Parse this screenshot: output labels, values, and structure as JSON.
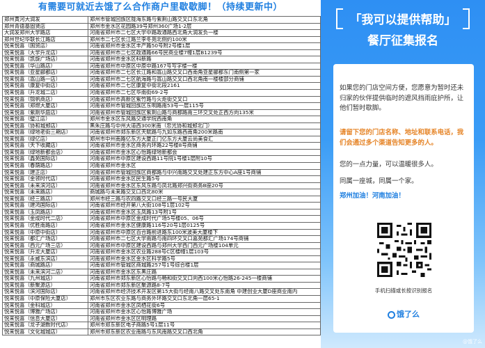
{
  "left": {
    "title": "有需要可就近去饿了么合作商户里歇歇脚！（持续更新中）",
    "rows": [
      [
        "郑州黄河大润发",
        "郑州市管城回族区陇海东路与紫荆山路交叉口东北角"
      ],
      [
        "郑州青德基固贤店",
        "郑州市金水区花园路39号郑州360广场1-2层"
      ],
      [
        "大润发郑州大学路店",
        "河南省郑州市二七区大学中路政通路西北角大润发负一楼"
      ],
      [
        "郑州世纪华联长江路店",
        "郑州市二七区长江路兰李冬苑北侧约100米"
      ],
      [
        "悦来悦喜（国贸店）",
        "河南省郑州市金水区丰产路50号附2号楼1层"
      ],
      [
        "悦来悦喜（大学升龙店）",
        "河南省郑州市二七区政通路66号民商业楼7幢1层B1239号"
      ],
      [
        "悦来悦喜（凯旋广场店）",
        "河南省郑州市金水区科新路"
      ],
      [
        "悦来悦喜（华山路店）",
        "河南省郑州市中原区中原中路167号写字楼一楼"
      ],
      [
        "悦来悦喜（亚星郦都店）",
        "河南省郑州市二七区长江路和嵩山路交叉口西南角亚星郦都东门南侧第一家"
      ],
      [
        "悦来悦喜（嵩山路一店）",
        "河南省郑州市二七区航海路与嵩山路交叉口西北角南一楼楼部分商铺"
      ],
      [
        "悦来悦喜（康复中街店）",
        "河南省郑州市二七区康复中街北段2161"
      ],
      [
        "悦来悦喜（升龙城二店）",
        "河南省郑州市二七区华南街69-2号"
      ],
      [
        "悦来悦喜（锦帆商店）",
        "河南省郑州市高新区紫竹路与火炬街交叉口"
      ],
      [
        "悦来悦喜（郑燃大厦店）",
        "河南省郑州市管城回族区东明路南53号一层115号"
      ],
      [
        "悦来悦喜（紫荆华庭店）",
        "河南省郑州市管城回族区紫荆山路与商都路南三环交叉处正西方向135米"
      ],
      [
        "悦来悦喜（璧江店）",
        "郑州市金水区东风路交通学院西南角"
      ],
      [
        "悦来悦喜（协和城郏店）",
        "黑朱庄路与中州大道西300米南（忠光协和城郏北门）"
      ],
      [
        "悦来悦喜（绿地老街三期店）",
        "河南省郑州市郑东新区天赋路与九如东路西南角200米路南"
      ],
      [
        "悦来悦喜（绿亿店）",
        "郑州市中州南路亿东方大厦正门亿东方大厦云尚美食汇"
      ],
      [
        "悦来悦喜（天下收藏店）",
        "河南省郑州市金水区商务内环路22号楼8号商铺"
      ],
      [
        "悦来悦喜（绿地新都会店）",
        "河南省郑州市金水区心怡路绿地新都会"
      ],
      [
        "悦来悦喜（鑫苑国际店）",
        "河南省郑州市中原区建设西路11号院1号楼1层附10号"
      ],
      [
        "悦来悦喜（春荫路店）",
        "河南省郑州市金水区"
      ],
      [
        "悦来悦喜（建正店）",
        "河南省郑州市管城回族区商都路与中兴南路交叉处建正东方中心A座1号商铺"
      ],
      [
        "悦来悦喜（金领时代店）",
        "河南省郑州市金水区民生路5号"
      ],
      [
        "悦来悦喜（未来滨河店）",
        "河南省郑州市金水区东风东路与凤北路郑兴街商务B座20号"
      ],
      [
        "悦来悦喜（未来路店）",
        "商城路与未来路交叉口西北80米"
      ],
      [
        "悦来悦喜（经三路店）",
        "郑州市经三路与农四路交叉口经三路一号民大厦"
      ],
      [
        "悦来悦喜（建鸿国际店）",
        "河南省郑州市经开第八大街108号1层102号"
      ],
      [
        "悦来悦喜（玉凤路店）",
        "河南省郑州市金水区玉凤路13号附1号"
      ],
      [
        "悦来悦喜（金成时代二店）",
        "河南省郑州市中原区金成时代广场5号楼05、06号"
      ],
      [
        "悦来悦喜（优胜南路店）",
        "河南省郑州市金水区健康路116号20号1层0125号"
      ],
      [
        "悦来悦喜（中原中街店）",
        "河南省郑州市中原区百合路前进路东100米波美大厦楼下"
      ],
      [
        "悦来悦喜（都汇广场店）",
        "河南省郑州市二七区大学南路与南四环交叉口嘉苑都汇广场174号商铺"
      ],
      [
        "悦来悦喜（西元广场三店）",
        "河南省郑州市中原区建设西路与郑州大学西门西元广场楼104单元"
      ],
      [
        "悦来悦喜（升龙大厦店）",
        "河南省郑州市金水区农业路288号C区楼幢1层103号"
      ],
      [
        "悦来悦喜（永威东滨店）",
        "河南省郑州市金水区金水区科学路5号"
      ],
      [
        "悦来悦喜（商城路店）",
        "河南省郑州市管城区商城路257号1号综合楼1层"
      ],
      [
        "悦来悦喜（未来滨河二店）",
        "河南省郑州市金水区东黑庄路"
      ],
      [
        "悦来悦喜（九州城店）",
        "河南省郑州市郑东新区心怡路与畅和街交叉口向西100米心怡路26-245一楼商铺"
      ],
      [
        "悦来悦喜（新聚源店）",
        "河南省郑州市郑东新区聚源路8-7号"
      ],
      [
        "悦来悦喜（滨河国际店）",
        "河南省郑州市经济技术开发区第15大街与经南八路交叉处东南角 中建创业大厦D座商业南内"
      ],
      [
        "悦来悦喜（中原保险大厦店）",
        "郑州市东区农业东路与商务外环路交叉口东北角一层65-1"
      ],
      [
        "悦来悦喜（金科城店）",
        "河南省郑州市金水区凤栖花街6号"
      ],
      [
        "悦来悦喜（博雅广场店）",
        "河南省郑州市金水区心怡路博雅广场"
      ],
      [
        "悦来悦喜（信息大厦店）",
        "河南省郑州市金水区区明理路"
      ],
      [
        "悦来悦喜（龙子湖数时代店）",
        "郑州市郑东新区电子商路5号1层11号"
      ],
      [
        "悦来悦喜（文化城城店）",
        "郑州市郑东新区农业南路与东风南路交叉口西北角"
      ]
    ]
  },
  "right": {
    "title_line1": "「我可以提供帮助」",
    "title_line2": "餐厅征集报名",
    "p1": "如果您的门店空间方便，您愿意为暂时还未归家的伙伴提供临时的遮风挡雨庇护所，让他们暂时歇脚。",
    "p2": "请留下您的门店名称、地址和联系电话，我们会通过多个渠道告知更多的人。",
    "p3": "您的一点力量，可以温暖很多人。",
    "p4": "同属一座城，同属一个家。",
    "p5": "郑州加油！河南加油！",
    "qr_caption": "手机扫描或长按识别报名",
    "logo_text": "饿了么",
    "watermark": "@饿了么",
    "colors": {
      "accent_blue": "#1f7fe0",
      "highlight_orange": "#e6862a"
    }
  }
}
